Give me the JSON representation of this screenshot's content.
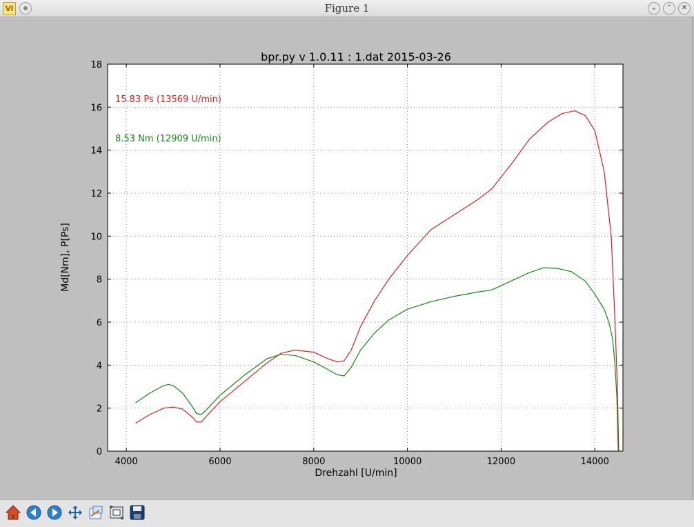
{
  "window": {
    "title": "Figure 1"
  },
  "chart_data": {
    "type": "line",
    "title": "bpr.py v 1.0.11 : 1.dat 2015-03-26",
    "xlabel": "Drehzahl [U/min]",
    "ylabel": "Md[Nm], P[Ps]",
    "xlim": [
      3600,
      14600
    ],
    "ylim": [
      0,
      18
    ],
    "xticks": [
      4000,
      6000,
      8000,
      10000,
      12000,
      14000
    ],
    "yticks": [
      0,
      2,
      4,
      6,
      8,
      10,
      12,
      14,
      16,
      18
    ],
    "grid": true,
    "annotations": [
      {
        "text": "15.83 Ps (13569 U/min)",
        "color": "#e31b1b"
      },
      {
        "text": "8.53 Nm (12909 U/min)",
        "color": "#118811"
      }
    ],
    "series": [
      {
        "color": "#e31b1b",
        "x": [
          4200,
          4500,
          4800,
          5000,
          5200,
          5400,
          5500,
          5600,
          5700,
          6000,
          6500,
          7000,
          7300,
          7600,
          8000,
          8300,
          8500,
          8650,
          8800,
          9000,
          9300,
          9600,
          10000,
          10500,
          11000,
          11500,
          11800,
          12200,
          12600,
          13000,
          13300,
          13569,
          13800,
          14000,
          14200,
          14350,
          14430,
          14480,
          14510
        ],
        "y": [
          1.3,
          1.7,
          2.0,
          2.05,
          1.95,
          1.6,
          1.35,
          1.35,
          1.6,
          2.3,
          3.2,
          4.1,
          4.55,
          4.7,
          4.6,
          4.3,
          4.15,
          4.2,
          4.7,
          5.8,
          7.0,
          8.0,
          9.1,
          10.3,
          11.0,
          11.7,
          12.2,
          13.3,
          14.5,
          15.3,
          15.7,
          15.83,
          15.6,
          14.9,
          13.0,
          10.0,
          6.0,
          3.0,
          0.0
        ]
      },
      {
        "color": "#118811",
        "x": [
          4200,
          4500,
          4800,
          4900,
          5000,
          5200,
          5400,
          5500,
          5600,
          5700,
          6000,
          6500,
          7000,
          7300,
          7600,
          8000,
          8300,
          8500,
          8650,
          8800,
          9000,
          9300,
          9600,
          10000,
          10500,
          11000,
          11500,
          11800,
          12200,
          12600,
          12909,
          13200,
          13500,
          13800,
          14000,
          14200,
          14300,
          14380,
          14430,
          14470,
          14500
        ],
        "y": [
          2.25,
          2.7,
          3.05,
          3.1,
          3.05,
          2.7,
          2.1,
          1.75,
          1.7,
          1.9,
          2.6,
          3.5,
          4.3,
          4.5,
          4.45,
          4.15,
          3.8,
          3.55,
          3.5,
          3.9,
          4.7,
          5.5,
          6.1,
          6.6,
          6.95,
          7.2,
          7.4,
          7.5,
          7.9,
          8.3,
          8.53,
          8.5,
          8.35,
          7.9,
          7.3,
          6.6,
          6.0,
          5.2,
          4.0,
          2.5,
          0.0
        ]
      }
    ]
  },
  "toolbar": {
    "icons": [
      "home-icon",
      "back-icon",
      "forward-icon",
      "pan-icon",
      "configure-subplots-icon",
      "zoom-rect-icon",
      "save-icon"
    ]
  }
}
